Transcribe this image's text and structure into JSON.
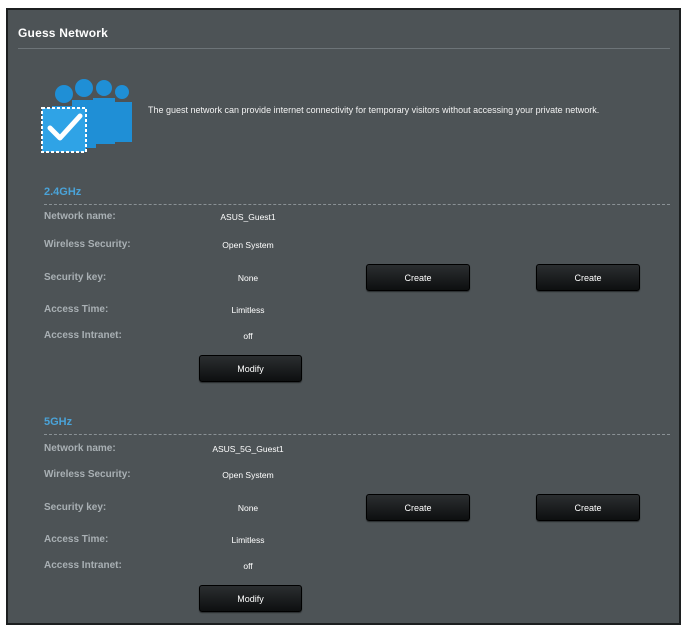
{
  "title": "Guess Network",
  "description": "The guest network can provide internet connectivity for temporary visitors without accessing your private network.",
  "icon": "guest-users-checkbox-icon",
  "colors": {
    "panel": "#4d5356",
    "band_label": "#4aa3d8",
    "field_label": "#a9b0b4",
    "button": "#111314",
    "icon_blue": "#1f8fd6"
  },
  "bands": [
    {
      "label": "2.4GHz",
      "fields": [
        {
          "label": "Network name:",
          "value": "ASUS_Guest1"
        },
        {
          "label": "Wireless Security:",
          "value": "Open System"
        },
        {
          "label": "Security key:",
          "value": "None"
        },
        {
          "label": "Access Time:",
          "value": "Limitless"
        },
        {
          "label": "Access Intranet:",
          "value": "off"
        }
      ],
      "create_buttons": [
        "Create",
        "Create"
      ],
      "modify_button": "Modify"
    },
    {
      "label": "5GHz",
      "fields": [
        {
          "label": "Network name:",
          "value": "ASUS_5G_Guest1"
        },
        {
          "label": "Wireless Security:",
          "value": "Open System"
        },
        {
          "label": "Security key:",
          "value": "None"
        },
        {
          "label": "Access Time:",
          "value": "Limitless"
        },
        {
          "label": "Access Intranet:",
          "value": "off"
        }
      ],
      "create_buttons": [
        "Create",
        "Create"
      ],
      "modify_button": "Modify"
    }
  ]
}
